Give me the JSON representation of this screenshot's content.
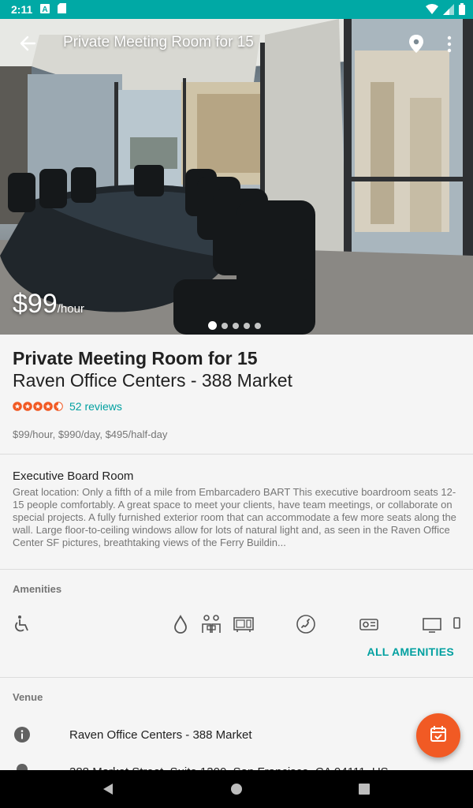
{
  "status_bar": {
    "time": "2:11",
    "icons": [
      "a-notification-icon",
      "sd-card-icon",
      "wifi-icon",
      "signal-icon",
      "battery-icon"
    ]
  },
  "header": {
    "title": "Private Meeting Room for 15",
    "back_icon": "arrow-back-icon",
    "map_icon": "map-pin-icon",
    "more_icon": "more-vert-icon"
  },
  "hero": {
    "price": "$99",
    "price_unit": "/hour",
    "carousel": {
      "count": 5,
      "active_index": 0
    }
  },
  "listing": {
    "title": "Private Meeting Room for 15",
    "venue_title": "Raven Office Centers - 388 Market",
    "rating": 4.5,
    "rating_max": 5,
    "reviews": "52 reviews",
    "rates": "$99/hour, $990/day, $495/half-day",
    "description_title": "Executive Board Room",
    "description": "Great location: Only a fifth of a mile from Embarcadero BART This executive boardroom seats 12-15 people comfortably. A great space to meet your clients, have team meetings, or collaborate on special projects. A fully furnished exterior room that can accommodate a few more seats along the wall. Large floor-to-ceiling windows allow for lots of natural light and, as seen in the Raven Office Center SF pictures, breathtaking views of the Ferry Buildin..."
  },
  "amenities": {
    "label": "Amenities",
    "icons": [
      "wheelchair-accessible-icon",
      "water-icon",
      "people-meeting-icon",
      "projector-icon",
      "phone-icon",
      "video-conference-icon",
      "tv-monitor-icon",
      "whiteboard-icon"
    ],
    "all_label": "ALL AMENITIES"
  },
  "venue": {
    "label": "Venue",
    "name": "Raven Office Centers - 388 Market",
    "address_partial": "388 Market Street, Suite 1300, San Francisco, CA 94111, US"
  },
  "fab": {
    "icon": "calendar-check-icon"
  },
  "colors": {
    "accent": "#00a9a5",
    "link": "#00a0a0",
    "fab": "#f15a24",
    "star": "#f15a24"
  }
}
